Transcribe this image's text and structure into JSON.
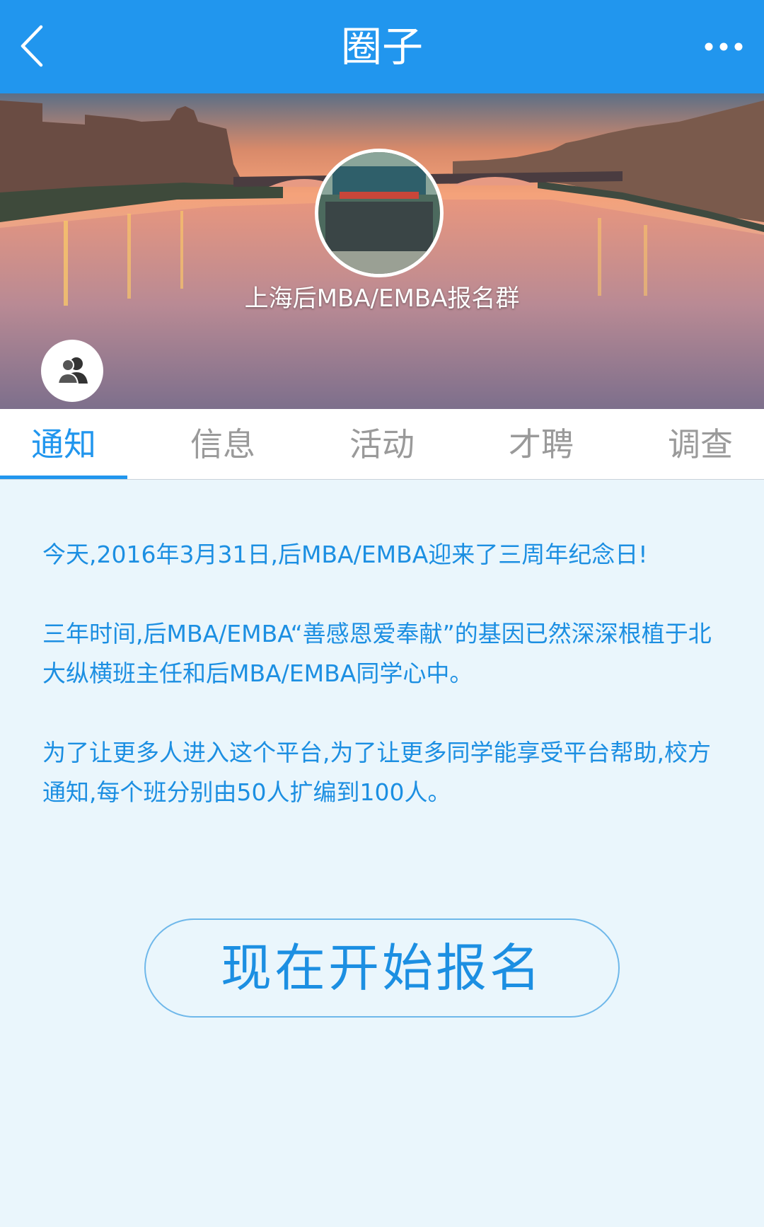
{
  "header": {
    "title": "圈子",
    "back_icon": "chevron-left-icon",
    "more_icon": "more-dots-icon",
    "background_color": "#2196ee"
  },
  "banner": {
    "group_name": "上海后MBA/EMBA报名群",
    "members_icon": "group-people-icon"
  },
  "tabs": [
    {
      "label": "通知",
      "active": true
    },
    {
      "label": "信息",
      "active": false
    },
    {
      "label": "活动",
      "active": false
    },
    {
      "label": "才聘",
      "active": false
    },
    {
      "label": "调查",
      "active": false
    }
  ],
  "notice": {
    "paragraphs": [
      "今天,2016年3月31日,后MBA/EMBA迎来了三周年纪念日!",
      "三年时间,后MBA/EMBA“善感恩爱奉献”的基因已然深深根植于北大纵横班主任和后MBA/EMBA同学心中。",
      "为了让更多人进入这个平台,为了让更多同学能享受平台帮助,校方通知,每个班分别由50人扩编到100人。"
    ]
  },
  "cta": {
    "label": "现在开始报名"
  },
  "colors": {
    "accent": "#2196ee",
    "text_blue": "#1c8fe2",
    "page_bg": "#eaf6fc",
    "tab_inactive": "#9a9a9a"
  }
}
